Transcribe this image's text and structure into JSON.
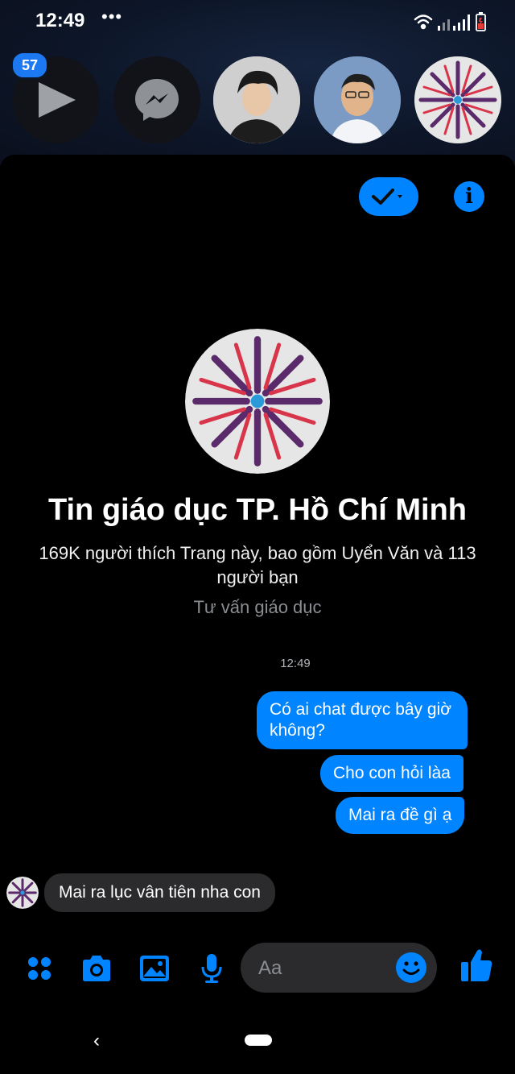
{
  "status_bar": {
    "time": "12:49",
    "dots": "•••"
  },
  "stories": {
    "badge_count": "57"
  },
  "page": {
    "title": "Tin giáo dục TP. Hồ Chí Minh",
    "likes_line": "169K người thích Trang này, bao gồm Uyển Văn và 113 người bạn",
    "category": "Tư vấn giáo dục"
  },
  "chat": {
    "timestamp": "12:49",
    "outgoing": [
      {
        "text": "Có ai chat được bây giờ không?"
      },
      {
        "text": "Cho con hỏi làa"
      },
      {
        "text": "Mai ra đề gì ạ"
      }
    ],
    "incoming": [
      {
        "text": "Mai ra lục vân tiên nha con"
      }
    ]
  },
  "composer": {
    "placeholder": "Aa"
  },
  "colors": {
    "accent": "#0084ff",
    "badge": "#1d79f2",
    "incoming_bubble": "#2b2b2d"
  },
  "icons": [
    "play-icon",
    "messenger-icon",
    "check-icon",
    "info-icon",
    "apps-icon",
    "camera-icon",
    "gallery-icon",
    "microphone-icon",
    "emoji-icon",
    "like-thumb-icon",
    "back-icon",
    "home-pill"
  ]
}
